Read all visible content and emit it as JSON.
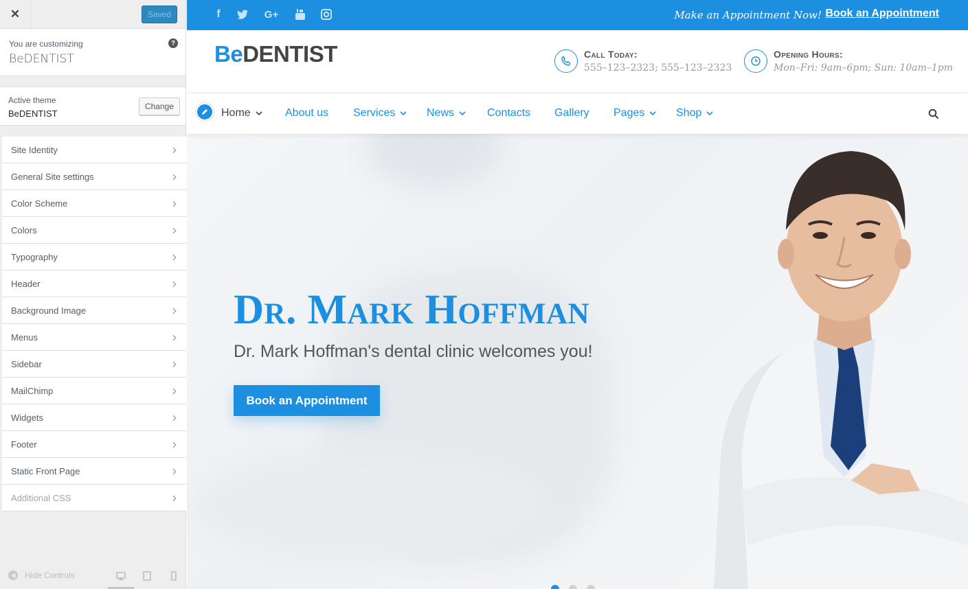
{
  "customizer": {
    "close_icon": "close-icon",
    "saved_label": "Saved",
    "customizing_label": "You are customizing",
    "site_name": "BeDENTIST",
    "help_icon": "question-icon",
    "active_theme_label": "Active theme",
    "active_theme_name": "BeDENTIST",
    "change_label": "Change",
    "sections": [
      {
        "label": "Site Identity"
      },
      {
        "label": "General Site settings"
      },
      {
        "label": "Color Scheme"
      },
      {
        "label": "Colors"
      },
      {
        "label": "Typography"
      },
      {
        "label": "Header"
      },
      {
        "label": "Background Image"
      },
      {
        "label": "Menus"
      },
      {
        "label": "Sidebar"
      },
      {
        "label": "MailChimp"
      },
      {
        "label": "Widgets"
      },
      {
        "label": "Footer"
      },
      {
        "label": "Static Front Page"
      },
      {
        "label": "Additional CSS"
      }
    ],
    "hide_controls_label": "Hide Controls",
    "devices": [
      "desktop-icon",
      "tablet-icon",
      "mobile-icon"
    ]
  },
  "site": {
    "social_icons": [
      "facebook-icon",
      "twitter-icon",
      "google-plus-icon",
      "youtube-icon",
      "instagram-icon"
    ],
    "topbar_text": "Make an Appointment Now!",
    "topbar_link": "Book an Appointment",
    "logo_be": "Be",
    "logo_dentist": "DENTIST",
    "call_title": "Call Today:",
    "call_numbers": "555–123–2323; 555–123–2323",
    "hours_title": "Opening Hours:",
    "hours_text": "Mon–Fri: 9am–6pm; Sun: 10am–1pm",
    "nav": [
      {
        "label": "Home",
        "dropdown": true,
        "active": true
      },
      {
        "label": "About us",
        "dropdown": false
      },
      {
        "label": "Services",
        "dropdown": true
      },
      {
        "label": "News",
        "dropdown": true
      },
      {
        "label": "Contacts",
        "dropdown": false
      },
      {
        "label": "Gallery",
        "dropdown": false
      },
      {
        "label": "Pages",
        "dropdown": true
      },
      {
        "label": "Shop",
        "dropdown": true
      }
    ],
    "hero_title": "Dr. Mark Hoffman",
    "hero_subtitle": "Dr. Mark Hoffman's dental clinic welcomes you!",
    "hero_button": "Book an Appointment",
    "slider_dots": 3,
    "colors": {
      "accent": "#1c8fe0",
      "saved_button": "#2d8ac1"
    }
  }
}
